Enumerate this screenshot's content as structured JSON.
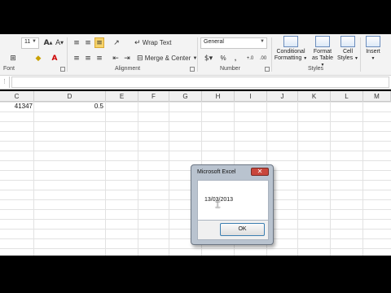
{
  "ribbon": {
    "font_size": "11",
    "wrap_text": "Wrap Text",
    "merge_center": "Merge & Center",
    "number_format": "General",
    "percent": "%",
    "comma": ",",
    "increase_decimal": "+.0",
    "decrease_decimal": ".00",
    "styles": {
      "conditional": "Conditional",
      "formatting": "Formatting",
      "format": "Format",
      "as_table": "as Table",
      "cell": "Cell",
      "cell_styles": "Styles",
      "insert": "Insert"
    },
    "groups": {
      "font": "Font",
      "alignment": "Alignment",
      "number": "Number",
      "styles": "Styles"
    }
  },
  "columns": [
    "C",
    "D",
    "E",
    "F",
    "G",
    "H",
    "I",
    "J",
    "K",
    "L",
    "M"
  ],
  "cells": {
    "c1": "41347",
    "d1": "0.5"
  },
  "dialog": {
    "title": "Microsoft Excel",
    "message": "13/03/2013",
    "ok_label": "OK",
    "close_glyph": "✕"
  },
  "colors": {
    "ribbon_bg": "#f3f3f3",
    "dialog_frame": "#b9c3cf",
    "close_button": "#c9463b",
    "ok_border": "#3c7fb1"
  }
}
